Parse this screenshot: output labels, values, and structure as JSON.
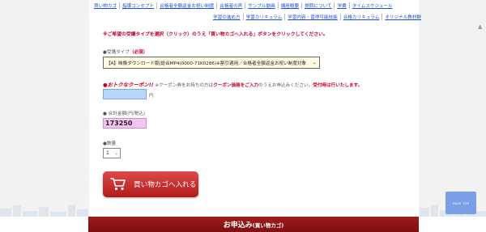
{
  "nav": {
    "row1": [
      "買い物カゴ",
      "指導コンセプト",
      "合格者全額返金お祝い制度",
      "合格者の声",
      "サンプル動画",
      "講座概要",
      "質問について",
      "学費",
      "タイムスケジュール"
    ],
    "row2": [
      "学習の進め方",
      "学習カリキュラム",
      "学習内容・習得可能技能",
      "合格カリキュラム",
      "オリジナル教材群"
    ]
  },
  "notice": "※ご希望の受講タイプを選択（クリック）のうえ「買い物カゴへ入れる」ボタンをクリックしてください。",
  "course_type": {
    "label": "●受講タイプ",
    "required": "（必須）",
    "selected": "【A】映像ダウンロード版[総合MP4(0000-71K0286)※割引適用／合格者全額返金お祝い制度対象"
  },
  "coupon": {
    "badge": "●おトクなクーポン!!",
    "text_prefix": "※クーポン券をお持ちの方は",
    "text_highlight": "クーポン価格をご入力",
    "text_mid": "のうえお申込みください。",
    "text_notice": "受付時は行いたします。",
    "unit": "円"
  },
  "total": {
    "label": "● 合計金額(円/税込)",
    "value": "173250"
  },
  "quantity": {
    "label": "●数量",
    "value": "1"
  },
  "cart_button": {
    "label": "買い物カゴへ入れる"
  },
  "page_top": {
    "label": "PAGE TOP"
  },
  "order_bar": {
    "title": "お申込み",
    "sub": "(買い物カゴ)"
  },
  "colors": {
    "accent_red": "#c3002f",
    "button_red": "#c42c2c",
    "link_blue": "#1a4fd6",
    "coupon_blue": "#b8d7f8",
    "total_pink": "#f6c6f3",
    "page_top_blue": "#7a9fe6",
    "order_bar_red": "#8e1515"
  }
}
